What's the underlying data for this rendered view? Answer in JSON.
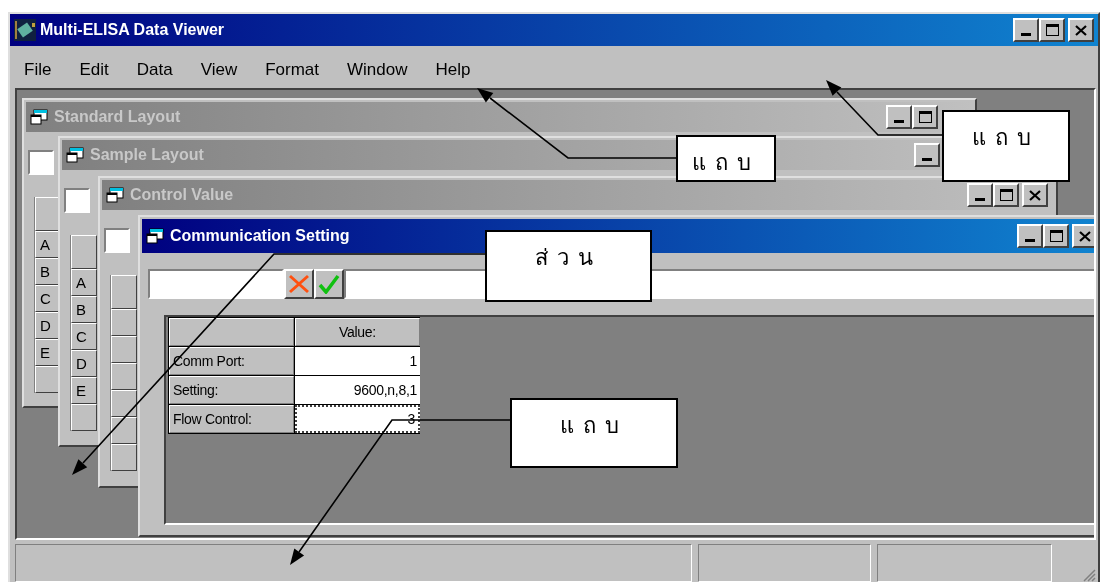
{
  "window": {
    "title": "Multi-ELISA Data Viewer"
  },
  "menu": [
    {
      "label": "File"
    },
    {
      "label": "Edit"
    },
    {
      "label": "Data"
    },
    {
      "label": "View"
    },
    {
      "label": "Format"
    },
    {
      "label": "Window"
    },
    {
      "label": "Help"
    }
  ],
  "child_windows": [
    {
      "kind": "layout",
      "title": "Standard Layout",
      "active": false,
      "row_labels": [
        "A",
        "B",
        "C",
        "D",
        "E"
      ]
    },
    {
      "kind": "layout",
      "title": "Sample Layout",
      "active": false,
      "row_labels": [
        "A",
        "B",
        "C",
        "D",
        "E"
      ]
    },
    {
      "kind": "layout",
      "title": "Control Value",
      "active": false
    },
    {
      "kind": "settings",
      "title": "Communication Setting",
      "active": true,
      "table": {
        "columns": [
          "Value:"
        ],
        "rows": [
          {
            "label": "Comm Port:",
            "value": "1",
            "focused": false
          },
          {
            "label": "Setting:",
            "value": "9600,n,8,1",
            "focused": false
          },
          {
            "label": "Flow Control:",
            "value": "3",
            "focused": true
          }
        ]
      }
    }
  ],
  "callouts": [
    {
      "text": "แถบ"
    },
    {
      "text": "แถบ"
    },
    {
      "text": "ส่วน"
    },
    {
      "text": "แถบ"
    }
  ]
}
